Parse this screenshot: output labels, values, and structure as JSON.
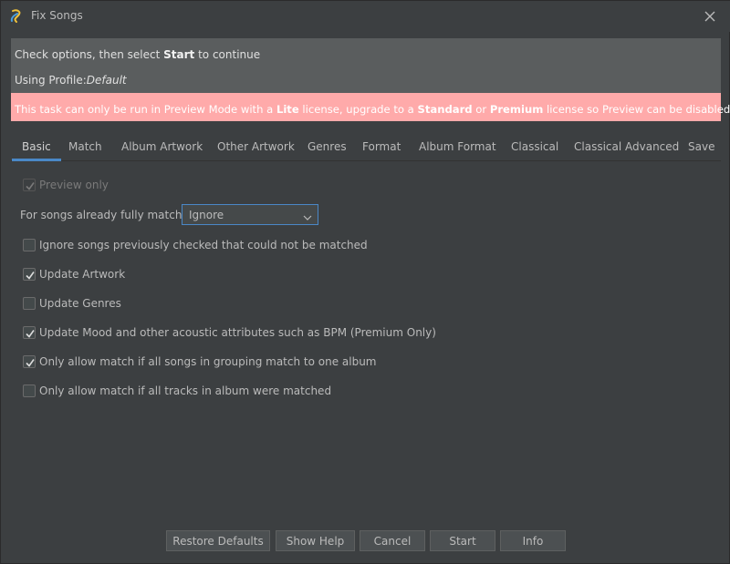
{
  "window": {
    "title": "Fix Songs"
  },
  "info": {
    "line1_pre": "Check options, then select ",
    "line1_bold": "Start",
    "line1_post": " to continue",
    "line2_label": "Using Profile:",
    "line2_value": "Default"
  },
  "warning": {
    "t1": "This task can only be run in Preview Mode with a ",
    "b1": "Lite",
    "t2": " license, upgrade to a ",
    "b2": "Standard",
    "t3": " or ",
    "b3": "Premium",
    "t4": " license so Preview can be disabled"
  },
  "tabs": [
    "Basic",
    "Match",
    "Album Artwork",
    "Other Artwork",
    "Genres",
    "Format",
    "Album Format",
    "Classical",
    "Classical Advanced",
    "Save"
  ],
  "active_tab": "Basic",
  "options": {
    "preview_only": {
      "label": "Preview only",
      "checked": true,
      "enabled": false
    },
    "fully_matched_label": "For songs already fully matched",
    "fully_matched_value": "Ignore",
    "ignore_prev": {
      "label": "Ignore songs previously checked that could not be matched",
      "checked": false
    },
    "update_artwork": {
      "label": "Update Artwork",
      "checked": true
    },
    "update_genres": {
      "label": "Update Genres",
      "checked": false
    },
    "update_mood": {
      "label": "Update Mood and other acoustic attributes such as BPM (Premium Only)",
      "checked": true
    },
    "grouping_match": {
      "label": "Only allow match if all songs in grouping match to one album",
      "checked": true
    },
    "tracks_matched": {
      "label": "Only allow match if all tracks in album were matched",
      "checked": false
    }
  },
  "buttons": {
    "restore": "Restore Defaults",
    "help": "Show Help",
    "cancel": "Cancel",
    "start": "Start",
    "info": "Info"
  },
  "colors": {
    "background": "#3c3f41",
    "info_panel": "#5a5d5e",
    "warning_bg": "#ffaaaa",
    "accent": "#4a88c7"
  }
}
